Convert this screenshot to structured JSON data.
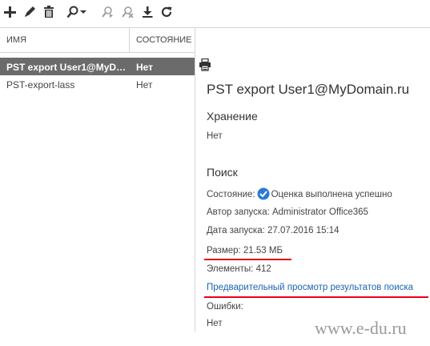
{
  "toolbar": {
    "icons": [
      "add-icon",
      "edit-icon",
      "delete-icon",
      "search-icon",
      "search-dropdown-icon",
      "start-search-icon",
      "stop-search-icon",
      "export-icon",
      "refresh-icon"
    ]
  },
  "columns": {
    "name": "ИМЯ",
    "status": "СОСТОЯНИЕ"
  },
  "rows": [
    {
      "name": "PST export User1@MyDomain.ru",
      "status": "Нет",
      "selected": true
    },
    {
      "name": "PST-export-lass",
      "status": "Нет",
      "selected": false
    }
  ],
  "details": {
    "title": "PST export User1@MyDomain.ru",
    "storage": {
      "heading": "Хранение",
      "value": "Нет"
    },
    "search": {
      "heading": "Поиск",
      "status_label": "Состояние:",
      "status_value": "Оценка выполнена успешно",
      "author": "Автор запуска: Administrator Office365",
      "date": "Дата запуска: 27.07.2016 15:14",
      "size": "Размер: 21.53 МБ",
      "items": "Элементы: 412",
      "preview_link": "Предварительный просмотр результатов поиска",
      "errors_label": "Ошибки:",
      "errors_value": "Нет"
    }
  },
  "annotations": {
    "underline_color": "#e8001c"
  },
  "colors": {
    "selected_row": "#6b6b6b",
    "link": "#1a64b4",
    "ok": "#2a7ad8"
  },
  "watermark": "www.e-du.ru"
}
